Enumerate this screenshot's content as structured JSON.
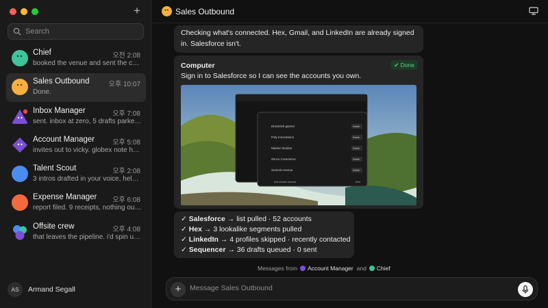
{
  "search": {
    "placeholder": "Search"
  },
  "chats": [
    {
      "name": "Chief",
      "time": "오전 2:08",
      "preview": "booked the venue and sent the c…",
      "avatar_color": "#3fc39b",
      "icon": "smiley-avatar"
    },
    {
      "name": "Sales Outbound",
      "time": "오후 10:07",
      "preview": "Done.",
      "avatar_color": "#f5b041",
      "icon": "smiley-avatar",
      "active": true
    },
    {
      "name": "Inbox Manager",
      "time": "오후 7:08",
      "preview": "sent. inbox at zero, 5 drafts parke…",
      "avatar_color": "#7a4fd6",
      "icon": "triangle-avatar"
    },
    {
      "name": "Account Manager",
      "time": "오후 5:08",
      "preview": "invites out to vicky. globex note h…",
      "avatar_color": "#7a4fd6",
      "icon": "diamond-avatar"
    },
    {
      "name": "Talent Scout",
      "time": "오후 2:08",
      "preview": "3 intros drafted in your voice, hel…",
      "avatar_color": "#4a8cf0",
      "icon": "circle-avatar"
    },
    {
      "name": "Expense Manager",
      "time": "오후 6:08",
      "preview": "report filed. 9 receipts, nothing ou…",
      "avatar_color": "#f26a3c",
      "icon": "circle-avatar"
    },
    {
      "name": "Offsite crew",
      "time": "오후 4:08",
      "preview": "that leaves the pipeline. i'd spin u…",
      "avatar_color": "#4a8cf0",
      "icon": "group-avatar"
    }
  ],
  "user": {
    "initials": "AS",
    "name": "Armand Segall"
  },
  "header": {
    "title": "Sales Outbound",
    "accent": "#f5b041"
  },
  "messages": {
    "m1": "Checking what's connected. Hex, Gmail, and LinkedIn are already signed in. Salesforce isn't.",
    "m2": {
      "sender": "Computer",
      "badge": "✔ Done",
      "text": "Sign in to Salesforce so I can see the accounts you own.",
      "screenshot": {
        "rows": [
          "Dreamish games",
          "Poly Innovations",
          "Marker Studios",
          "Zenco Commerce",
          "Summit Avenue"
        ],
        "row_button": "Switch",
        "footer_left": "Add another account",
        "footer_right": "Next"
      }
    },
    "m3": [
      {
        "check": "✓",
        "service": "Salesforce",
        "detail": " → list pulled · 52 accounts"
      },
      {
        "check": "✓",
        "service": "Hex",
        "detail": " → 3 lookalike segments pulled"
      },
      {
        "check": "✓",
        "service": "LinkedIn",
        "detail": " → 4 profiles skipped · recently contacted"
      },
      {
        "check": "✓",
        "service": "Sequencer",
        "detail": " → 36 drafts queued · 0 sent"
      }
    ]
  },
  "participants": {
    "prefix": "Messages from",
    "first": "Account Manager",
    "first_color": "#7a4fd6",
    "joiner": "and",
    "second": "Chief",
    "second_color": "#3fc39b"
  },
  "composer": {
    "placeholder": "Message Sales Outbound",
    "add": "+"
  }
}
